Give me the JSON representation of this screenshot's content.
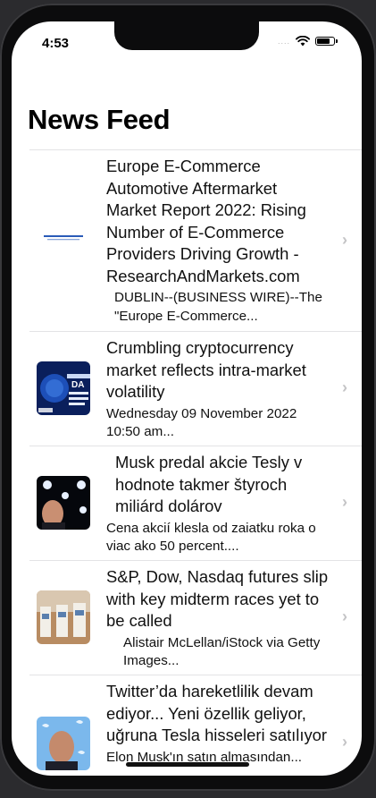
{
  "status": {
    "time": "4:53",
    "signal": "....",
    "battery_level": 0.8
  },
  "title": "News Feed",
  "articles": [
    {
      "headline": "Europe E-Commerce Automotive Aftermarket Market Report 2022: Rising Number of E-Commerce Providers Driving Growth - ResearchAndMarkets.com",
      "snippet": "DUBLIN--(BUSINESS WIRE)--The \"Europe E-Commerce...",
      "thumb": "research-and-markets-logo"
    },
    {
      "headline": "Crumbling cryptocurrency market reflects intra-market volatility",
      "snippet": "Wednesday 09 November 2022 10:50 am...",
      "thumb": "crypto-graphic"
    },
    {
      "headline": "Musk predal akcie Tesly v hodnote takmer štyroch miliárd dolárov",
      "snippet": "Cena akcií klesla od zaiatku roka o viac ako 50 percent....",
      "thumb": "musk-photo"
    },
    {
      "headline": "S&P, Dow, Nasdaq futures slip with key midterm races yet to be called",
      "snippet": "Alistair McLellan/iStock via Getty Images...",
      "thumb": "voting-booths-photo"
    },
    {
      "headline": "Twitter’da hareketlilik devam ediyor... Yeni özellik geliyor, uğruna Tesla hisseleri satılıyor",
      "snippet": "Elon Musk'ın satın almasından...",
      "thumb": "musk-twitter-photo"
    }
  ]
}
